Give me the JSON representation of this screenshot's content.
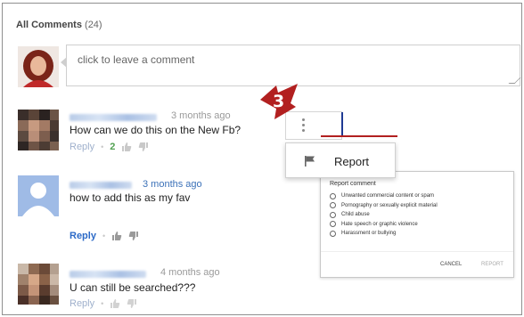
{
  "header": {
    "title": "All Comments",
    "count": "(24)"
  },
  "composer": {
    "placeholder": "click to leave a comment"
  },
  "comments": [
    {
      "time": "3 months ago",
      "text": "How can we do this on the New Fb?",
      "reply": "Reply",
      "likes": "2"
    },
    {
      "time": "3 months ago",
      "text": "how to add this as my fav",
      "reply": "Reply"
    },
    {
      "time": "4 months ago",
      "text": "U can still be searched???",
      "reply": "Reply"
    }
  ],
  "menu": {
    "report_label": "Report"
  },
  "report_dialog": {
    "title": "Report comment",
    "options": [
      "Unwanted commercial content or spam",
      "Pornography or sexually explicit material",
      "Child abuse",
      "Hate speech or graphic violence",
      "Harassment or bullying"
    ],
    "cancel": "CANCEL",
    "submit": "REPORT"
  },
  "callout": {
    "step": "3"
  },
  "colors": {
    "link": "#2c6ac7",
    "callout": "#b22020",
    "likes": "#52a152"
  },
  "icons": [
    "kebab-icon",
    "flag-icon",
    "thumbs-up-icon",
    "thumbs-down-icon",
    "resize-handle-icon"
  ]
}
